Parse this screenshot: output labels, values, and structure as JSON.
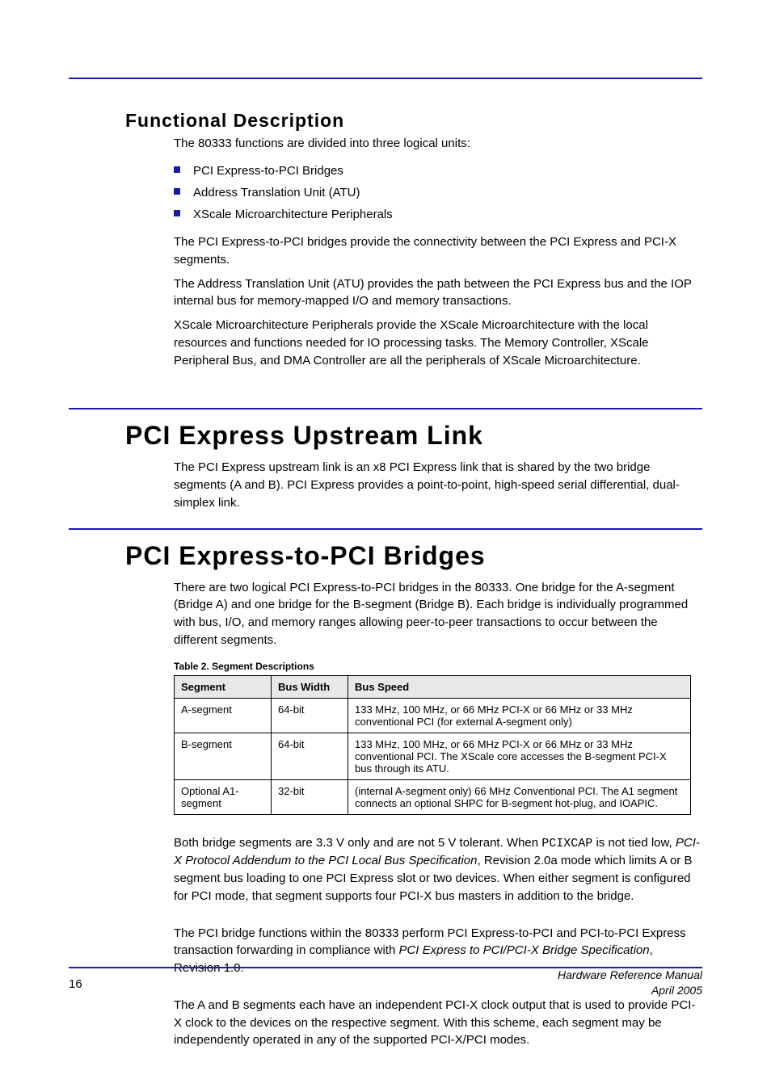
{
  "heading": "Functional Description",
  "intro": "The 80333 functions are divided into three logical units:",
  "bullets": [
    "PCI Express-to-PCI Bridges",
    "Address Translation Unit (ATU)",
    "XScale Microarchitecture Peripherals"
  ],
  "paras": {
    "p1": "The PCI Express-to-PCI bridges provide the connectivity between the PCI Express and PCI-X segments.",
    "p2": "The Address Translation Unit (ATU) provides the path between the PCI Express bus and the IOP internal bus for memory-mapped I/O and memory transactions.",
    "p3": "XScale Microarchitecture Peripherals provide the XScale Microarchitecture with the local resources and functions needed for IO processing tasks. The Memory Controller, XScale Peripheral Bus, and DMA Controller are all the peripherals of XScale Microarchitecture."
  },
  "sub1": {
    "title": "PCI Express Upstream Link",
    "para": "The PCI Express upstream link is an x8 PCI Express link that is shared by the two bridge segments (A and B). PCI Express provides a point-to-point, high-speed serial differential, dual-simplex link."
  },
  "sub2": {
    "title": "PCI Express-to-PCI Bridges",
    "para": "There are two logical PCI Express-to-PCI bridges in the 80333. One bridge for the A-segment (Bridge A) and one bridge for the B-segment (Bridge B). Each bridge is individually programmed with bus, I/O, and memory ranges allowing peer-to-peer transactions to occur between the different segments.",
    "tableTitle": "Table 2. Segment Descriptions",
    "tableHeaders": [
      "Segment",
      "Bus Width",
      "Bus Speed"
    ],
    "rows": [
      {
        "segment": "A-segment",
        "width": "64-bit",
        "speed": "133 MHz, 100 MHz, or 66 MHz PCI-X or 66 MHz or 33 MHz conventional PCI (for external A-segment only)"
      },
      {
        "segment": "B-segment",
        "width": "64-bit",
        "speed": "133 MHz, 100 MHz, or 66 MHz PCI-X or 66 MHz or 33 MHz conventional PCI. The XScale core accesses the B-segment PCI-X bus through its ATU."
      },
      {
        "segment": "Optional A1-segment",
        "width": "32-bit",
        "speed": "(internal A-segment only) 66 MHz Conventional PCI. The A1 segment connects an optional SHPC for B-segment hot-plug, and IOAPIC."
      }
    ],
    "post": {
      "l1_a": "Both bridge segments are 3.3 V only and are not 5 V tolerant. When ",
      "l1_code": "PCIXCAP",
      "l1_b": " is not tied low, ",
      "l1_italic": "PCI-X Protocol Addendum to the PCI Local Bus Specification",
      "l1_c": ", Revision 2.0a mode which limits A or B segment bus loading to one PCI Express slot or two devices. When either segment is configured for PCI mode, that segment supports four PCI-X bus masters in addition to the bridge.",
      "l2_a": "The PCI bridge functions within the 80333 perform PCI Express-to-PCI and PCI-to-PCI Express transaction forwarding in compliance with ",
      "l2_italic": "PCI Express to PCI/PCI-X Bridge Specification",
      "l2_b": ", Revision 1.0.",
      "l3": "The A and B segments each have an independent PCI-X clock output that is used to provide PCI-X clock to the devices on the respective segment. With this scheme, each segment may be independently operated in any of the supported PCI-X/PCI modes."
    }
  },
  "footer": {
    "left": "16",
    "rightTop": "Hardware Reference Manual",
    "rightBottom": "April 2005"
  }
}
